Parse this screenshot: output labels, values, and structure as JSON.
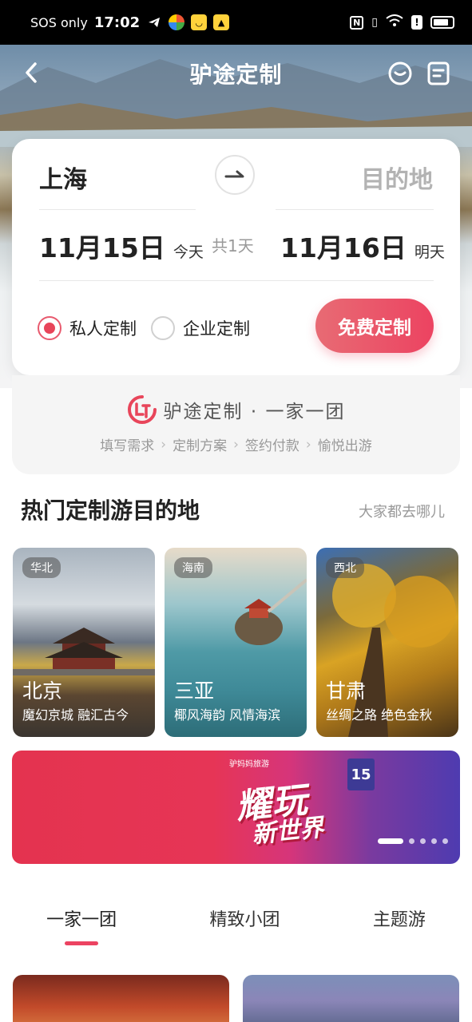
{
  "status_bar": {
    "carrier": "SOS only",
    "time": "17:02",
    "icons": [
      "telegram-icon",
      "app-icon-1",
      "app-icon-2",
      "app-icon-3",
      "nfc-icon",
      "vibrate-icon",
      "wifi-icon",
      "alert-icon",
      "battery-icon"
    ]
  },
  "nav": {
    "title": "驴途定制",
    "back_icon": "chevron-left-icon",
    "chat_icon": "chat-bubble-icon",
    "orders_icon": "order-list-icon"
  },
  "search": {
    "from_city": "上海",
    "to_city": "目的地",
    "swap_icon": "arrow-right-icon",
    "start_date": "11月15日",
    "start_day": "今天",
    "duration": "共1天",
    "end_date": "11月16日",
    "end_day": "明天",
    "options": [
      {
        "label": "私人定制",
        "checked": true
      },
      {
        "label": "企业定制",
        "checked": false
      }
    ],
    "cta": "免费定制"
  },
  "brand": {
    "slogan": "驴途定制 · 一家一团",
    "steps": [
      "填写需求",
      "定制方案",
      "签约付款",
      "愉悦出游"
    ]
  },
  "hot": {
    "title": "热门定制游目的地",
    "more": "大家都去哪儿",
    "destinations": [
      {
        "region": "华北",
        "name": "北京",
        "desc": "魔幻京城 融汇古今"
      },
      {
        "region": "海南",
        "name": "三亚",
        "desc": "椰风海韵 风情海滨"
      },
      {
        "region": "西北",
        "name": "甘肃",
        "desc": "丝绸之路 绝色金秋"
      }
    ]
  },
  "banner": {
    "line1": "耀玩",
    "line2": "新世界",
    "badge": "15",
    "small": "驴妈妈旅游"
  },
  "tabs": [
    {
      "label": "一家一团",
      "active": true
    },
    {
      "label": "精致小团",
      "active": false
    },
    {
      "label": "主题游",
      "active": false
    }
  ],
  "colors": {
    "accent": "#ec4361",
    "card_bg": "#ffffff",
    "muted": "#999999"
  }
}
